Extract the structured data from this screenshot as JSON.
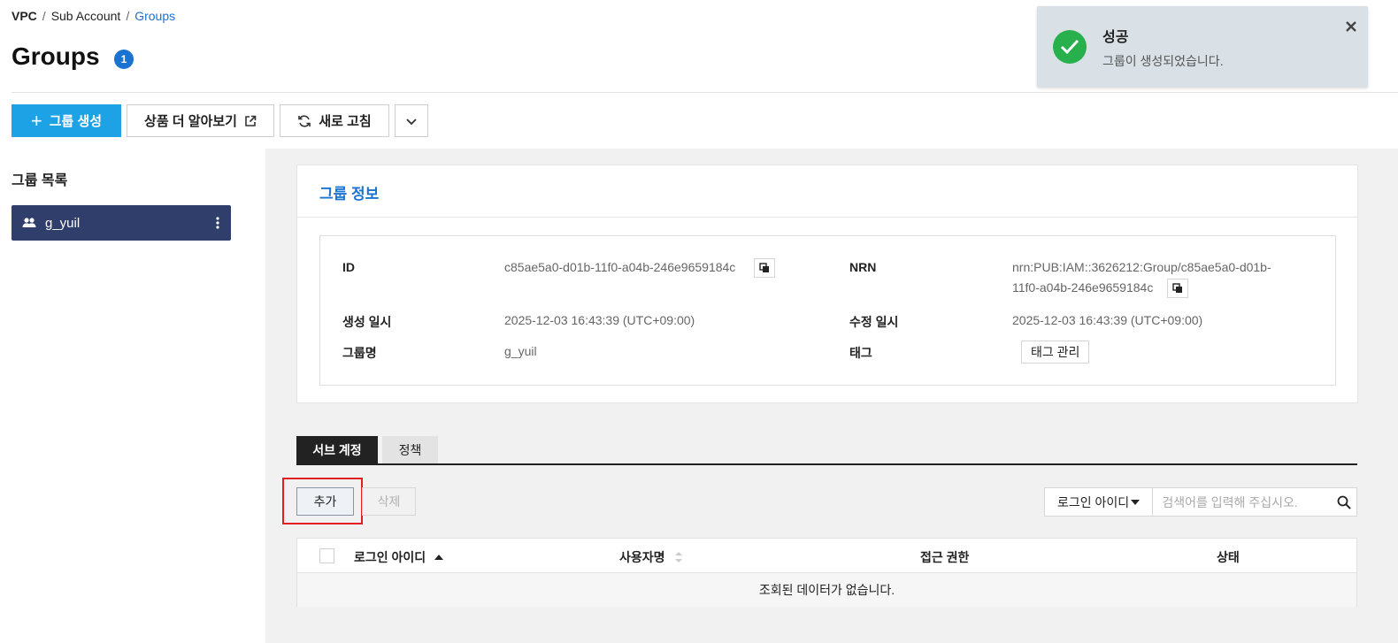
{
  "breadcrumb": {
    "vpc": "VPC",
    "sep": "/",
    "sub_account": "Sub Account",
    "groups": "Groups"
  },
  "page": {
    "title": "Groups",
    "count": "1"
  },
  "toolbar": {
    "create_label": "그룹 생성",
    "learn_more_label": "상품 더 알아보기",
    "refresh_label": "새로 고침"
  },
  "sidebar": {
    "title": "그룹 목록",
    "items": [
      {
        "label": "g_yuil",
        "selected": true
      }
    ]
  },
  "group_info": {
    "title": "그룹 정보",
    "id_label": "ID",
    "id_value": "c85ae5a0-d01b-11f0-a04b-246e9659184c",
    "nrn_label": "NRN",
    "nrn_value_line1": "nrn:PUB:IAM::3626212:Group/c85ae5a0-d01b-",
    "nrn_value_line2": "11f0-a04b-246e9659184c",
    "created_label": "생성 일시",
    "created_value": "2025-12-03 16:43:39 (UTC+09:00)",
    "modified_label": "수정 일시",
    "modified_value": "2025-12-03 16:43:39 (UTC+09:00)",
    "name_label": "그룹명",
    "name_value": "g_yuil",
    "tag_label": "태그",
    "tag_button": "태그 관리"
  },
  "tabs": [
    {
      "label": "서브 계정",
      "active": true
    },
    {
      "label": "정책",
      "active": false
    }
  ],
  "actions": {
    "add_label": "추가",
    "delete_label": "삭제"
  },
  "search": {
    "field_selected": "로그인 아이디",
    "placeholder": "검색어를 입력해 주십시오."
  },
  "table": {
    "columns": [
      "로그인 아이디",
      "사용자명",
      "접근 권한",
      "상태"
    ],
    "empty_message": "조회된 데이터가 없습니다."
  },
  "toast": {
    "title": "성공",
    "message": "그룹이 생성되었습니다."
  },
  "colors": {
    "primary": "#1ea2e6",
    "link": "#1b73d1",
    "sidebar_selected": "#2f3e6b",
    "success": "#27b04b",
    "highlight": "#e02020"
  }
}
